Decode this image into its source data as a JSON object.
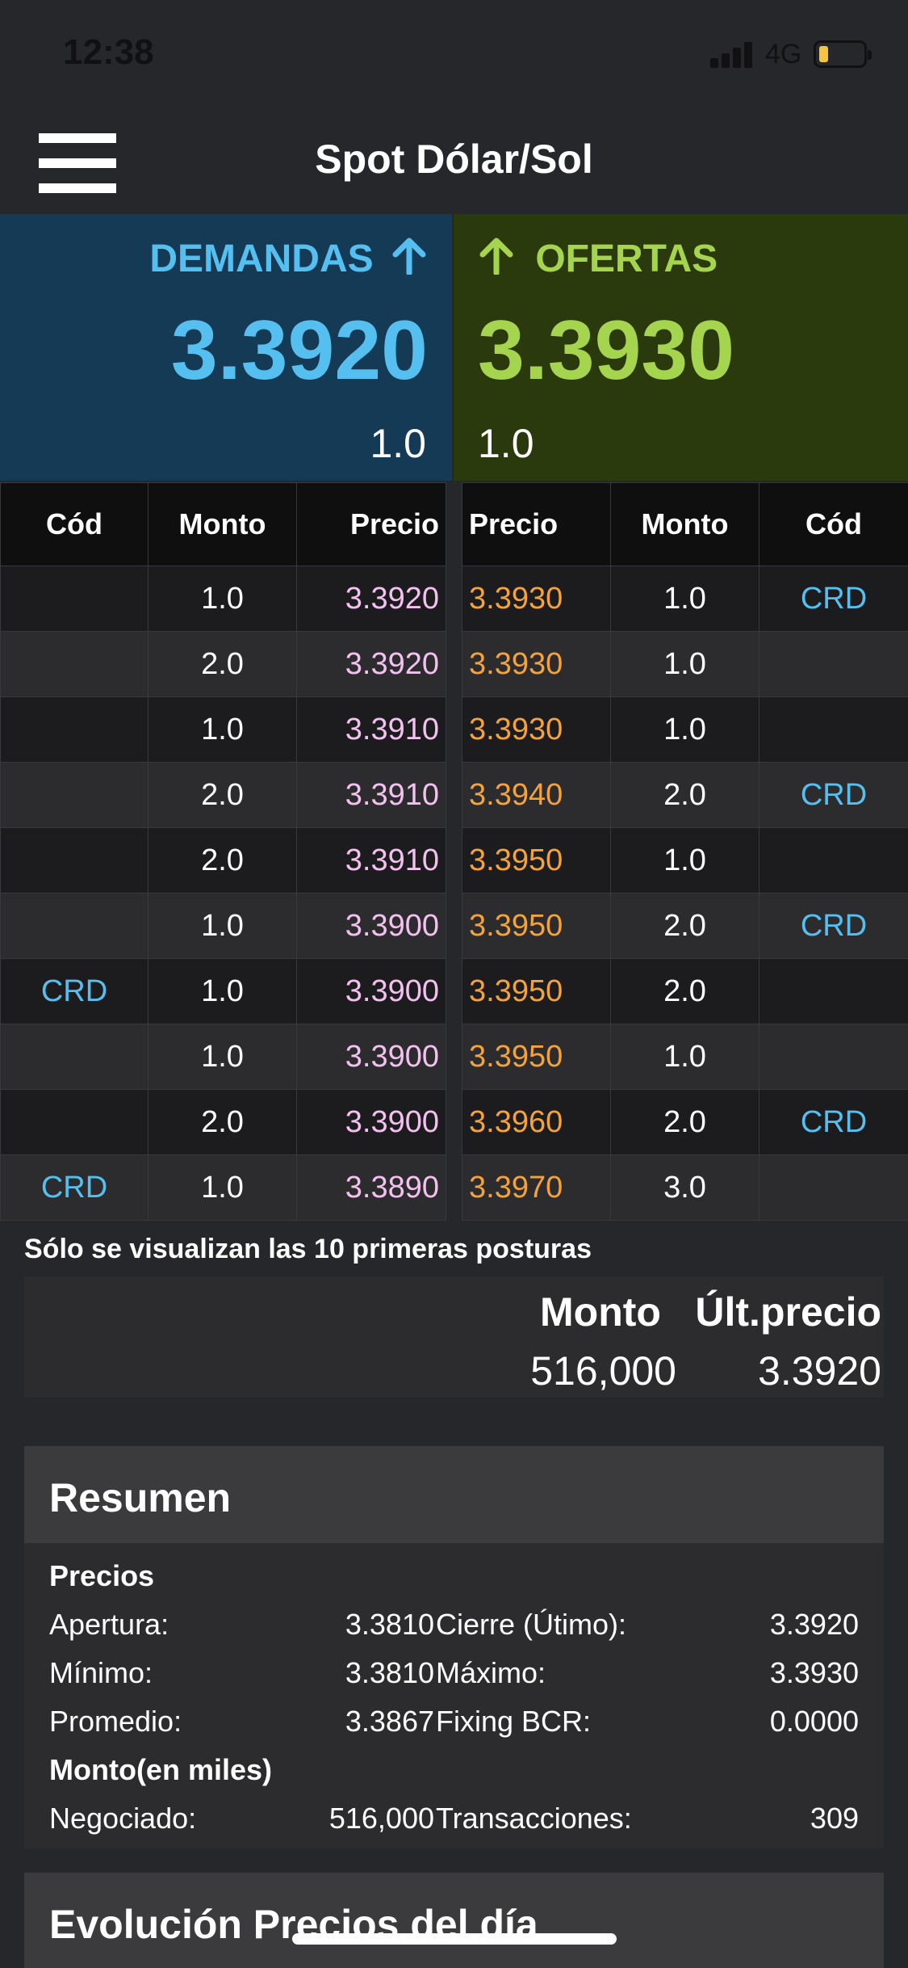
{
  "status": {
    "time": "12:38",
    "network": "4G",
    "battery_level": 0.2
  },
  "header": {
    "title": "Spot Dólar/Sol"
  },
  "quotes": {
    "bid": {
      "label": "DEMANDAS",
      "price": "3.3920",
      "size": "1.0",
      "color": "#55bff0"
    },
    "ask": {
      "label": "OFERTAS",
      "price": "3.3930",
      "size": "1.0",
      "color": "#a5d44e"
    }
  },
  "order_book": {
    "bids": {
      "headers": [
        "Cód",
        "Monto",
        "Precio"
      ],
      "rows": [
        [
          "",
          "1.0",
          "3.3920"
        ],
        [
          "",
          "2.0",
          "3.3920"
        ],
        [
          "",
          "1.0",
          "3.3910"
        ],
        [
          "",
          "2.0",
          "3.3910"
        ],
        [
          "",
          "2.0",
          "3.3910"
        ],
        [
          "",
          "1.0",
          "3.3900"
        ],
        [
          "CRD",
          "1.0",
          "3.3900"
        ],
        [
          "",
          "1.0",
          "3.3900"
        ],
        [
          "",
          "2.0",
          "3.3900"
        ],
        [
          "CRD",
          "1.0",
          "3.3890"
        ]
      ]
    },
    "offers": {
      "headers": [
        "Precio",
        "Monto",
        "Cód"
      ],
      "rows": [
        [
          "3.3930",
          "1.0",
          "CRD"
        ],
        [
          "3.3930",
          "1.0",
          ""
        ],
        [
          "3.3930",
          "1.0",
          ""
        ],
        [
          "3.3940",
          "2.0",
          "CRD"
        ],
        [
          "3.3950",
          "1.0",
          ""
        ],
        [
          "3.3950",
          "2.0",
          "CRD"
        ],
        [
          "3.3950",
          "2.0",
          ""
        ],
        [
          "3.3950",
          "1.0",
          ""
        ],
        [
          "3.3960",
          "2.0",
          "CRD"
        ],
        [
          "3.3970",
          "3.0",
          ""
        ]
      ]
    },
    "note": "Sólo se visualizan las 10 primeras posturas"
  },
  "last_trade": {
    "monto_label": "Monto",
    "precio_label": "Últ.precio",
    "monto": "516,000",
    "precio": "3.3920"
  },
  "summary": {
    "title": "Resumen",
    "prices_heading": "Precios",
    "apertura_label": "Apertura:",
    "apertura": "3.3810",
    "cierre_label": "Cierre (Útimo):",
    "cierre": "3.3920",
    "minimo_label": "Mínimo:",
    "minimo": "3.3810",
    "maximo_label": "Máximo:",
    "maximo": "3.3930",
    "promedio_label": "Promedio:",
    "promedio": "3.3867",
    "fixing_label": "Fixing BCR:",
    "fixing": "0.0000",
    "amount_heading": "Monto(en miles)",
    "negociado_label": "Negociado:",
    "negociado": "516,000",
    "transacciones_label": "Transacciones:",
    "transacciones": "309"
  },
  "evolution": {
    "title": "Evolución Precios del día"
  }
}
